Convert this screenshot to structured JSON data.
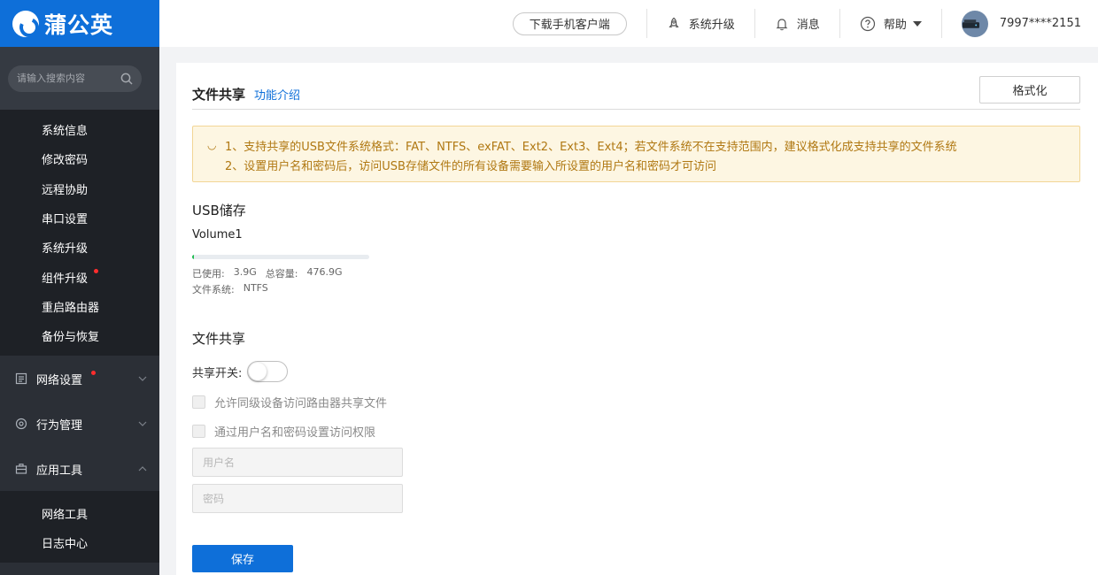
{
  "brand": {
    "name": "蒲公英",
    "color": "#0e6fd9"
  },
  "search": {
    "placeholder": "请输入搜索内容",
    "icon": "search-icon"
  },
  "sidebar": {
    "sub_items": [
      {
        "label": "系统信息",
        "dot": false
      },
      {
        "label": "修改密码",
        "dot": false
      },
      {
        "label": "远程协助",
        "dot": false
      },
      {
        "label": "串口设置",
        "dot": false
      },
      {
        "label": "系统升级",
        "dot": false
      },
      {
        "label": "组件升级",
        "dot": true
      },
      {
        "label": "重启路由器",
        "dot": false
      },
      {
        "label": "备份与恢复",
        "dot": false
      }
    ],
    "groups": [
      {
        "label": "网络设置",
        "icon": "document-icon",
        "dot": true,
        "expanded": false
      },
      {
        "label": "行为管理",
        "icon": "target-icon",
        "dot": false,
        "expanded": false
      },
      {
        "label": "应用工具",
        "icon": "toolbox-icon",
        "dot": false,
        "expanded": true
      }
    ],
    "app_tools_items": [
      {
        "label": "网络工具"
      },
      {
        "label": "日志中心"
      }
    ]
  },
  "topbar": {
    "download_label": "下载手机客户端",
    "upgrade_label": "系统升级",
    "messages_label": "消息",
    "help_label": "帮助",
    "user_id": "7997****2151"
  },
  "page": {
    "title": "文件共享",
    "intro_link": "功能介绍",
    "format_button": "格式化",
    "notice": {
      "line1": "1、支持共享的USB文件系统格式：FAT、NTFS、exFAT、Ext2、Ext3、Ext4；若文件系统不在支持范围内，建议格式化成支持共享的文件系统",
      "line2": "2、设置用户名和密码后，访问USB存储文件的所有设备需要输入所设置的用户名和密码才可访问"
    },
    "usb": {
      "section_title": "USB储存",
      "volume_name": "Volume1",
      "used_label": "已使用:",
      "used_value": "3.9G",
      "total_label": "总容量:",
      "total_value": "476.9G",
      "fs_label": "文件系统:",
      "fs_value": "NTFS",
      "usage_fraction": 0.008
    },
    "share": {
      "section_title": "文件共享",
      "switch_label": "共享开关:",
      "switch_on": false,
      "option1": "允许同级设备访问路由器共享文件",
      "option2": "通过用户名和密码设置访问权限",
      "username_placeholder": "用户名",
      "password_placeholder": "密码",
      "save_label": "保存"
    }
  }
}
